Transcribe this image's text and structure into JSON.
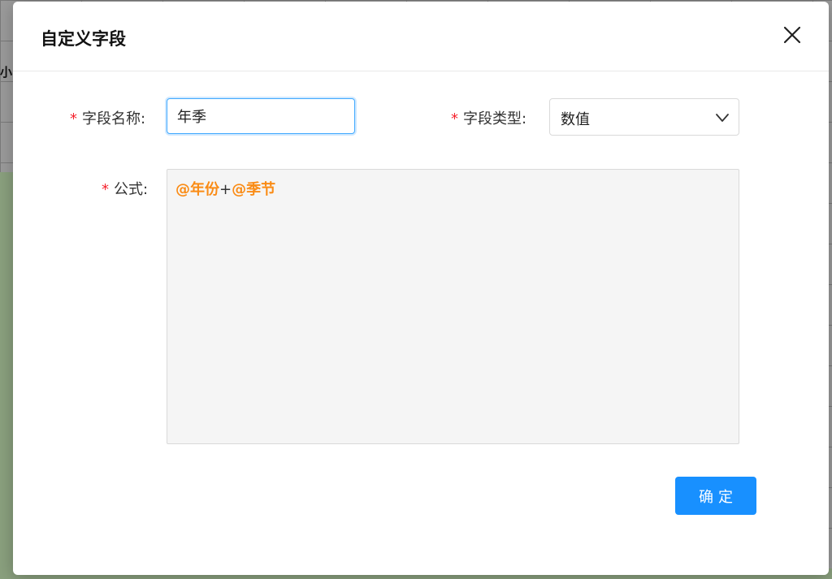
{
  "background": {
    "header_fragment": "小"
  },
  "dialog": {
    "title": "自定义字段",
    "close_icon": "close-icon",
    "fields": {
      "name": {
        "required_mark": "*",
        "label": "字段名称:",
        "value": "年季"
      },
      "type": {
        "required_mark": "*",
        "label": "字段类型:",
        "selected": "数值",
        "icon": "chevron-down-icon"
      },
      "formula": {
        "required_mark": "*",
        "label": "公式:",
        "tokens": {
          "var1": "@年份",
          "op": "+",
          "var2": "@季节"
        }
      }
    },
    "confirm_label": "确定"
  },
  "colors": {
    "primary": "#1890ff",
    "required": "#f5222d",
    "formula_variable": "#fa8c16",
    "formula_background": "#f5f5f5"
  }
}
